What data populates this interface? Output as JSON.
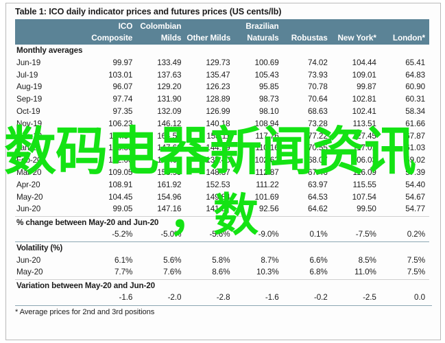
{
  "document": {
    "table_title": "Table 1: ICO daily indicator prices and futures prices (US cents/lb)",
    "footnote_marker": "*",
    "footnote_text": " Average prices for 2nd and 3rd positions"
  },
  "header": {
    "blank": "",
    "top_row": [
      "",
      "ICO",
      "Colombian",
      "",
      "Brazilian",
      "",
      "",
      ""
    ],
    "bottom_row": [
      "",
      "Composite",
      "Milds",
      "Other Milds",
      "Naturals",
      "Robustas",
      "New York*",
      "London*"
    ],
    "columns": [
      {
        "line1": "ICO",
        "line2": "Composite"
      },
      {
        "line1": "Colombian",
        "line2": "Milds"
      },
      {
        "line1": "",
        "line2": "Other Milds"
      },
      {
        "line1": "Brazilian",
        "line2": "Naturals"
      },
      {
        "line1": "",
        "line2": "Robustas"
      },
      {
        "line1": "",
        "line2": "New York*"
      },
      {
        "line1": "",
        "line2": "London*"
      }
    ]
  },
  "sections": {
    "monthly_averages_label": "Monthly averages",
    "pct_change_label": "% change between May-20 and Jun-20",
    "volatility_label": "Volatility (%)",
    "variation_label": "Variation between May-20 and Jun-20"
  },
  "monthly_averages": [
    {
      "month": "Jun-19",
      "values": [
        "99.97",
        "133.49",
        "129.73",
        "100.69",
        "74.02",
        "104.44",
        "65.41"
      ]
    },
    {
      "month": "Jul-19",
      "values": [
        "103.01",
        "137.63",
        "135.47",
        "105.43",
        "73.93",
        "109.01",
        "64.83"
      ]
    },
    {
      "month": "Aug-19",
      "values": [
        "96.07",
        "129.20",
        "126.23",
        "95.85",
        "70.78",
        "99.87",
        "60.90"
      ]
    },
    {
      "month": "Sep-19",
      "values": [
        "97.74",
        "131.90",
        "128.89",
        "98.73",
        "70.64",
        "102.81",
        "60.31"
      ]
    },
    {
      "month": "Oct-19",
      "values": [
        "97.35",
        "132.09",
        "126.99",
        "98.10",
        "68.63",
        "102.41",
        "58.34"
      ]
    },
    {
      "month": "Nov-19",
      "values": [
        "106.23",
        "146.12",
        "140.18",
        "108.94",
        "73.28",
        "113.51",
        "61.66"
      ]
    },
    {
      "month": "Dec-19",
      "values": [
        "114.37",
        "164.50",
        "153.11",
        "117.76",
        "77.22",
        "127.45",
        "67.87"
      ]
    },
    {
      "month": "Jan-20",
      "values": [
        "106.39",
        "147.62",
        "144.19",
        "110.16",
        "70.55",
        "117.01",
        "61.03"
      ]
    },
    {
      "month": "Feb-20",
      "values": [
        "102.00",
        "146.03",
        "135.40",
        "102.62",
        "68.07",
        "106.03",
        "59.02"
      ]
    },
    {
      "month": "Mar-20",
      "values": [
        "109.05",
        "158.99",
        "148.37",
        "112.87",
        "67.46",
        "116.09",
        "57.39"
      ]
    },
    {
      "month": "Apr-20",
      "values": [
        "108.91",
        "161.92",
        "152.53",
        "111.22",
        "63.97",
        "115.55",
        "54.40"
      ]
    },
    {
      "month": "May-20",
      "values": [
        "104.45",
        "154.96",
        "149.84",
        "101.69",
        "64.53",
        "107.54",
        "54.67"
      ]
    },
    {
      "month": "Jun-20",
      "values": [
        "99.05",
        "147.16",
        "141.57",
        "92.56",
        "64.62",
        "99.50",
        "54.77"
      ]
    }
  ],
  "pct_change": {
    "month": "",
    "values": [
      "-5.2%",
      "-5.0%",
      "-5.6%",
      "-9.0%",
      "0.1%",
      "-7.5%",
      "0.2%"
    ]
  },
  "volatility": [
    {
      "month": "Jun-20",
      "values": [
        "6.1%",
        "5.6%",
        "5.8%",
        "8.7%",
        "6.6%",
        "8.5%",
        "7.5%"
      ]
    },
    {
      "month": "May-20",
      "values": [
        "7.7%",
        "7.6%",
        "8.6%",
        "10.3%",
        "6.8%",
        "11.0%",
        "7.5%"
      ]
    }
  ],
  "variation": {
    "month": "",
    "values": [
      "-1.6",
      "-2.0",
      "-2.8",
      "-1.6",
      "-0.2",
      "-2.5",
      "0.0"
    ]
  },
  "watermark": {
    "line1": "数码电器新闻资讯",
    "line2": "，数",
    "color": "#14e314"
  },
  "colors": {
    "header_band": "#5b8396",
    "rule": "#8aa6b2",
    "text": "#1c1c1c",
    "page_background": "#ffffff"
  }
}
